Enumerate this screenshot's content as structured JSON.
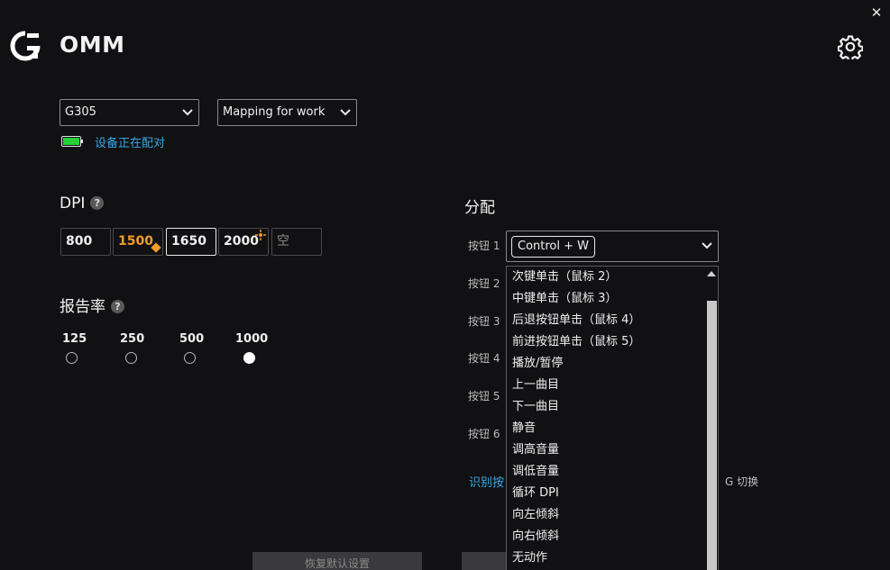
{
  "app": {
    "title": "OMM"
  },
  "device": {
    "selected": "G305",
    "status": "设备正在配对"
  },
  "profile": {
    "selected": "Mapping for work"
  },
  "dpi": {
    "title": "DPI",
    "help": "?",
    "levels": [
      "800",
      "1500",
      "1650",
      "2000",
      "空"
    ],
    "default_level": "1500",
    "active_level": "1650",
    "shift_level": "2000"
  },
  "report_rate": {
    "title": "报告率",
    "help": "?",
    "options": [
      "125",
      "250",
      "500",
      "1000"
    ],
    "selected": "1000"
  },
  "assignment": {
    "title": "分配",
    "buttons": [
      "按钮 1",
      "按钮 2",
      "按钮 3",
      "按钮 4",
      "按钮 5",
      "按钮 6"
    ],
    "current_value": "Control + W",
    "identify_link": "识别按",
    "gshift_text": "G 切换",
    "dropdown_items": [
      "次键单击（鼠标 2）",
      "中键单击（鼠标 3）",
      "后退按钮单击（鼠标 4）",
      "前进按钮单击（鼠标 5）",
      "播放/暂停",
      "上一曲目",
      "下一曲目",
      "静音",
      "调高音量",
      "调低音量",
      "循环 DPI",
      "向左倾斜",
      "向右倾斜",
      "无动作"
    ]
  },
  "footer": {
    "restore_defaults": "恢复默认设置"
  },
  "colors": {
    "accent_blue": "#35a9e6",
    "default_dpi_orange": "#f39c2b",
    "battery_green": "#23d036",
    "background": "#111113"
  },
  "icons": [
    "logitech-g-icon",
    "gear-icon",
    "close-icon",
    "chevron-down-icon",
    "battery-icon",
    "help-icon",
    "dpi-shift-icon"
  ]
}
